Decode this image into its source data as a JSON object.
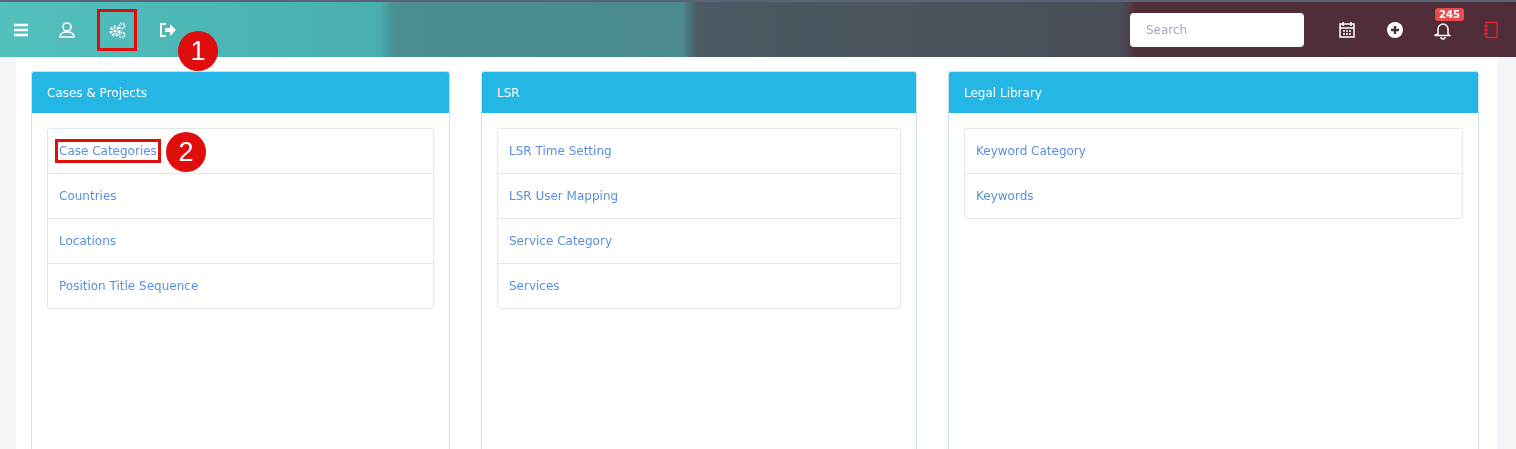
{
  "toolbar": {
    "left_icons": [
      {
        "kind": "menu"
      },
      {
        "kind": "user"
      },
      {
        "kind": "settings",
        "callout": "1"
      },
      {
        "kind": "logout"
      }
    ],
    "search": {
      "placeholder": "Search"
    },
    "right_icons": [
      {
        "kind": "calendar"
      },
      {
        "kind": "add"
      },
      {
        "kind": "bell",
        "badge": "245"
      },
      {
        "kind": "notebook"
      }
    ]
  },
  "panels": [
    {
      "title": "Cases & Projects",
      "items": [
        {
          "label": "Case Categories",
          "callout": "2"
        },
        {
          "label": "Countries"
        },
        {
          "label": "Locations"
        },
        {
          "label": "Position Title Sequence"
        }
      ]
    },
    {
      "title": "LSR",
      "items": [
        {
          "label": "LSR Time Setting"
        },
        {
          "label": "LSR User Mapping"
        },
        {
          "label": "Service Category"
        },
        {
          "label": "Services"
        }
      ]
    },
    {
      "title": "Legal Library",
      "items": [
        {
          "label": "Keyword Category"
        },
        {
          "label": "Keywords"
        }
      ]
    }
  ]
}
